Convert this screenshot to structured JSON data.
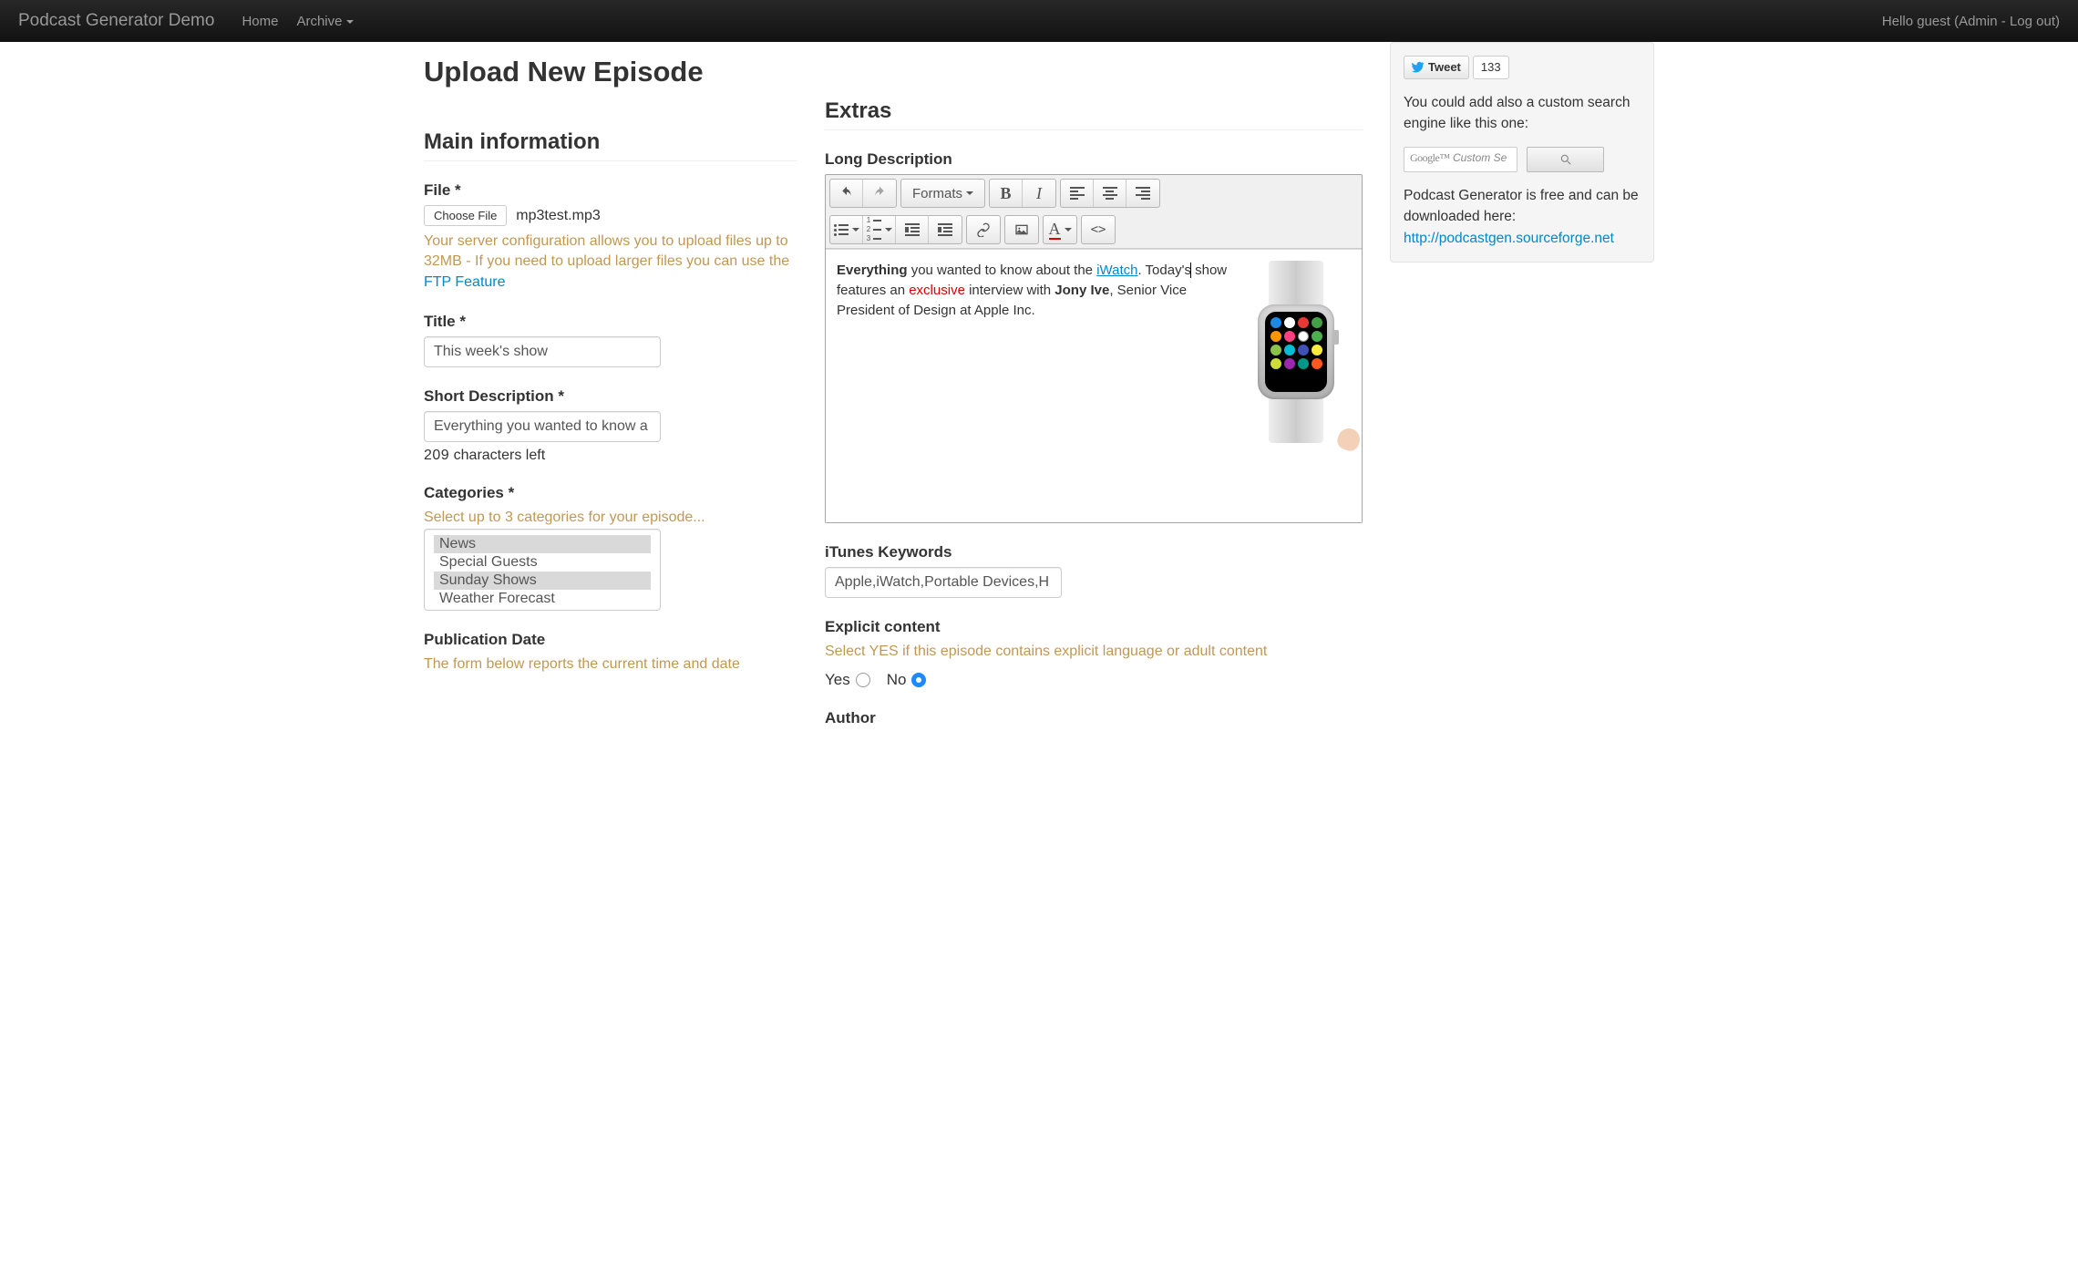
{
  "navbar": {
    "brand": "Podcast Generator Demo",
    "home": "Home",
    "archive": "Archive",
    "greeting_prefix": "Hello guest (",
    "admin": "Admin",
    "sep": " - ",
    "logout": "Log out",
    "greeting_suffix": ")"
  },
  "page": {
    "title": "Upload New Episode"
  },
  "main": {
    "section": "Main information",
    "file_label": "File *",
    "choose_file": "Choose File",
    "file_name": "mp3test.mp3",
    "file_hint_1": "Your server configuration allows you to upload files up to 32MB - If you need to upload larger files you can use the ",
    "file_hint_link": "FTP Feature",
    "title_label": "Title *",
    "title_value": "This week's show",
    "short_desc_label": "Short Description *",
    "short_desc_value": "Everything you wanted to know a",
    "chars_count": "209",
    "chars_text": "characters left",
    "categories_label": "Categories *",
    "categories_hint": "Select up to 3 categories for your episode...",
    "categories": [
      "News",
      "Special Guests",
      "Sunday Shows",
      "Weather Forecast"
    ],
    "categories_selected": [
      0,
      2
    ],
    "pubdate_label": "Publication Date",
    "pubdate_hint": "The form below reports the current time and date"
  },
  "extras": {
    "section": "Extras",
    "long_desc_label": "Long Description",
    "formats": "Formats",
    "editor": {
      "strong1": "Everything",
      "t1": " you wanted to know about the ",
      "link": "iWatch",
      "t2": ". Today's",
      "t2b": " show features an ",
      "red": "exclusive",
      "t3": " interview with ",
      "strong2": "Jony Ive",
      "t4": ", Senior Vice President of Design at Apple Inc."
    },
    "itunes_label": "iTunes Keywords",
    "itunes_value": "Apple,iWatch,Portable Devices,H",
    "explicit_label": "Explicit content",
    "explicit_hint": "Select YES if this episode contains explicit language or adult content",
    "yes": "Yes",
    "no": "No",
    "explicit_value": "no",
    "author_label": "Author"
  },
  "sidebar": {
    "tweet": "Tweet",
    "tweet_count": "133",
    "text1": "You could add also a custom search engine like this one:",
    "search_placeholder": "Custom Se",
    "google": "Google™",
    "text2": "Podcast Generator is free and can be downloaded here:",
    "link": "http://podcastgen.sourceforge.net"
  }
}
